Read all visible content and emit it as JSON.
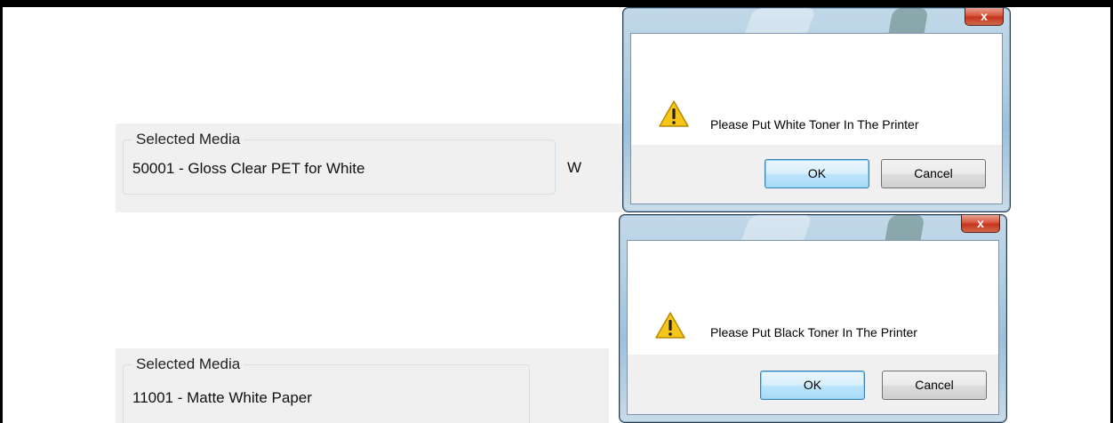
{
  "panels": [
    {
      "legend": "Selected Media",
      "value": "50001 - Gloss Clear PET for White",
      "marker": "W"
    },
    {
      "legend": "Selected Media",
      "value": "11001 - Matte White Paper"
    }
  ],
  "dialogs": [
    {
      "close_label": "x",
      "icon": "warning-icon",
      "message": "Please Put White Toner In The Printer",
      "ok_label": "OK",
      "cancel_label": "Cancel"
    },
    {
      "close_label": "x",
      "icon": "warning-icon",
      "message": "Please Put Black Toner In The Printer",
      "ok_label": "OK",
      "cancel_label": "Cancel"
    }
  ],
  "colors": {
    "close_button": "#c4341c",
    "warning": "#f5c518",
    "panel_bg": "#f0f0f0"
  }
}
